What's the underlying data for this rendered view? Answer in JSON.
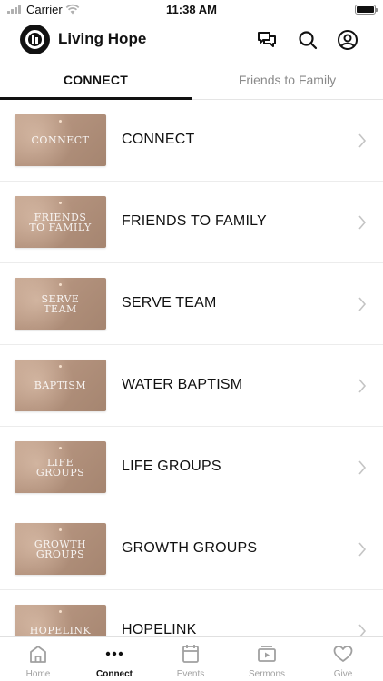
{
  "status_bar": {
    "carrier": "Carrier",
    "time": "11:38 AM"
  },
  "header": {
    "app_name": "Living Hope",
    "icons": [
      "chat-icon",
      "search-icon",
      "account-icon"
    ]
  },
  "tabs": [
    {
      "label": "CONNECT",
      "active": true
    },
    {
      "label": "Friends to Family",
      "active": false
    }
  ],
  "list": {
    "items": [
      {
        "label": "CONNECT",
        "thumb_text": "CONNECT"
      },
      {
        "label": "FRIENDS TO FAMILY",
        "thumb_text": "FRIENDS\nTO FAMILY"
      },
      {
        "label": "SERVE TEAM",
        "thumb_text": "SERVE\nTEAM"
      },
      {
        "label": "WATER BAPTISM",
        "thumb_text": "BAPTISM"
      },
      {
        "label": "LIFE GROUPS",
        "thumb_text": "LIFE\nGROUPS"
      },
      {
        "label": "GROWTH GROUPS",
        "thumb_text": "GROWTH\nGROUPS"
      },
      {
        "label": "HOPELINK",
        "thumb_text": "HOPELINK"
      }
    ]
  },
  "bottom_nav": [
    {
      "label": "Home",
      "icon": "home-icon",
      "active": false
    },
    {
      "label": "Connect",
      "icon": "more-dots-icon",
      "active": true
    },
    {
      "label": "Events",
      "icon": "calendar-icon",
      "active": false
    },
    {
      "label": "Sermons",
      "icon": "video-icon",
      "active": false
    },
    {
      "label": "Give",
      "icon": "heart-icon",
      "active": false
    }
  ],
  "colors": {
    "text": "#111111",
    "inactive": "#a0a0a0",
    "thumb": "#b2917c",
    "divider": "#ececec"
  }
}
